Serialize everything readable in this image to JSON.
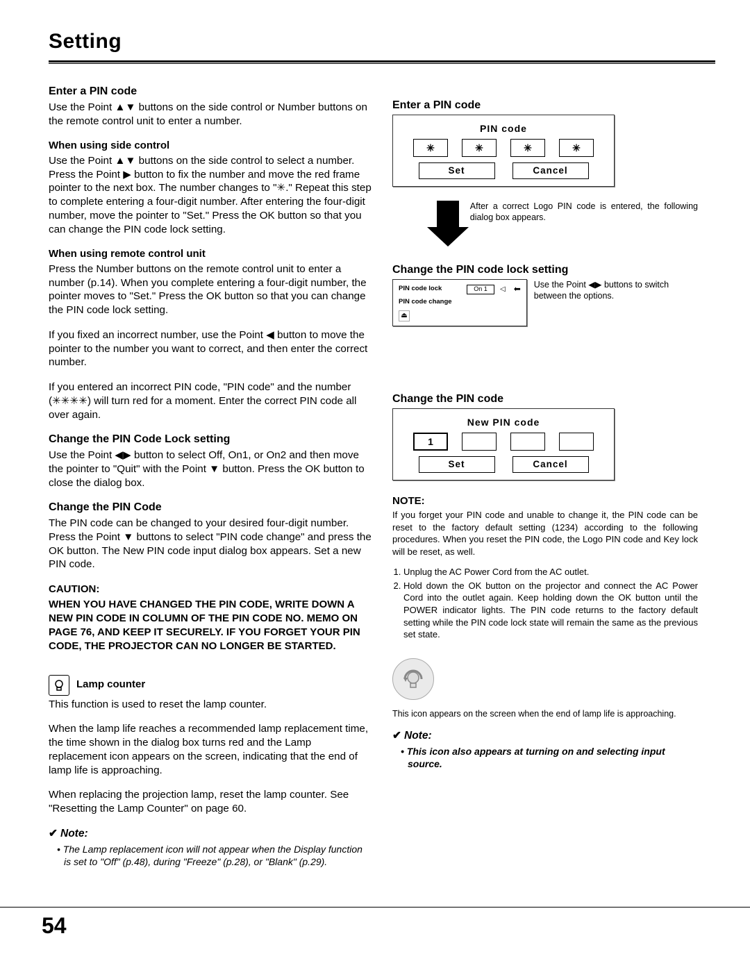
{
  "header": {
    "title": "Setting"
  },
  "left": {
    "h_enter": "Enter a PIN code",
    "p_enter": "Use the Point ▲▼ buttons on the side control or Number buttons on the remote control unit to enter a number.",
    "h_side": "When using side control",
    "p_side": "Use the Point ▲▼ buttons on the side control to select a number. Press the Point ▶ button to fix the number and move the red frame pointer to the next box. The number changes to \"✳.\" Repeat this step to complete entering a four-digit number. After entering the four-digit number, move the pointer to \"Set.\" Press the OK button so that you can change the PIN code lock setting.",
    "h_remote": "When using remote control unit",
    "p_remote": "Press the Number buttons on the remote control unit to enter a number (p.14). When you complete entering a four-digit number, the pointer moves to \"Set.\" Press the OK button so that you can change the PIN code lock setting.",
    "p_fix": " If you fixed an incorrect number, use the Point ◀ button to move the pointer to the number you want to correct, and then enter the correct number.",
    "p_wrong": "If you entered an incorrect PIN code, \"PIN code\" and the number (✳✳✳✳) will turn red for a moment. Enter the correct PIN code all over again.",
    "h_changelock": "Change the PIN Code Lock setting",
    "p_changelock": "Use the Point ◀▶ button to select Off, On1, or On2 and then move the pointer to \"Quit\" with the Point ▼ button. Press the OK button to close the dialog box.",
    "h_changepin": "Change the PIN Code",
    "p_changepin": "The PIN code can be changed to your desired four-digit number. Press the Point ▼ buttons to select \"PIN code change\" and press the OK button. The New PIN code input dialog box appears. Set a new PIN code.",
    "caution_head": "CAUTION:",
    "caution_body": "WHEN YOU HAVE CHANGED THE PIN CODE, WRITE DOWN A NEW PIN CODE IN COLUMN OF THE PIN CODE NO. MEMO ON PAGE 76, AND KEEP IT SECURELY. IF YOU FORGET YOUR PIN CODE, THE PROJECTOR CAN NO LONGER BE STARTED.",
    "h_lamp": "Lamp counter",
    "p_lamp1": "This function is used to reset the lamp counter.",
    "p_lamp2": "When the lamp life reaches a recommended lamp replacement time, the time shown in the dialog box turns red and the Lamp replacement icon appears on the screen, indicating that the end of lamp life is approaching.",
    "p_lamp3": "When replacing the projection lamp, reset the lamp counter. See \"Resetting the Lamp Counter\" on page 60.",
    "note_head": "Note:",
    "note_body": "• The Lamp replacement icon will not appear when the Display function is set to \"Off\" (p.48), during \"Freeze\" (p.28), or \"Blank\" (p.29)."
  },
  "right": {
    "h_enter": "Enter a PIN code",
    "pin_title": "PIN code",
    "pin_vals": [
      "✳",
      "✳",
      "✳",
      "✳"
    ],
    "btn_set": "Set",
    "btn_cancel": "Cancel",
    "after_text": "After a correct Logo PIN code is entered, the following dialog box appears.",
    "h_changelock": "Change the PIN code lock setting",
    "lock_l1": "PIN code lock",
    "lock_v1": "On 1",
    "lock_l2": "PIN code change",
    "lock_note": "Use the Point ◀▶ buttons to switch between the options.",
    "h_changepin": "Change the PIN code",
    "new_title": "New PIN code",
    "new_vals": [
      "1",
      "",
      "",
      ""
    ],
    "note_head": "NOTE:",
    "note_p": "If you forget your PIN code and unable to change it, the PIN code can be reset to the factory default setting (1234) according to the following procedures. When you reset the PIN code, the Logo PIN code and Key lock will be reset, as well.",
    "note_li1": "Unplug the AC Power Cord from the AC outlet.",
    "note_li2": "Hold down the OK button on the projector and connect the AC Power Cord into the outlet again. Keep holding down the OK button until the POWER indicator lights. The PIN code returns to the factory default setting while the PIN code lock state will remain the same as the previous set state.",
    "lamp_caption": "This icon appears on the screen when the end of lamp life is approaching.",
    "rnote_head": "Note:",
    "rnote_body": "• This icon also appears at turning on and selecting input source."
  },
  "page_number": "54"
}
